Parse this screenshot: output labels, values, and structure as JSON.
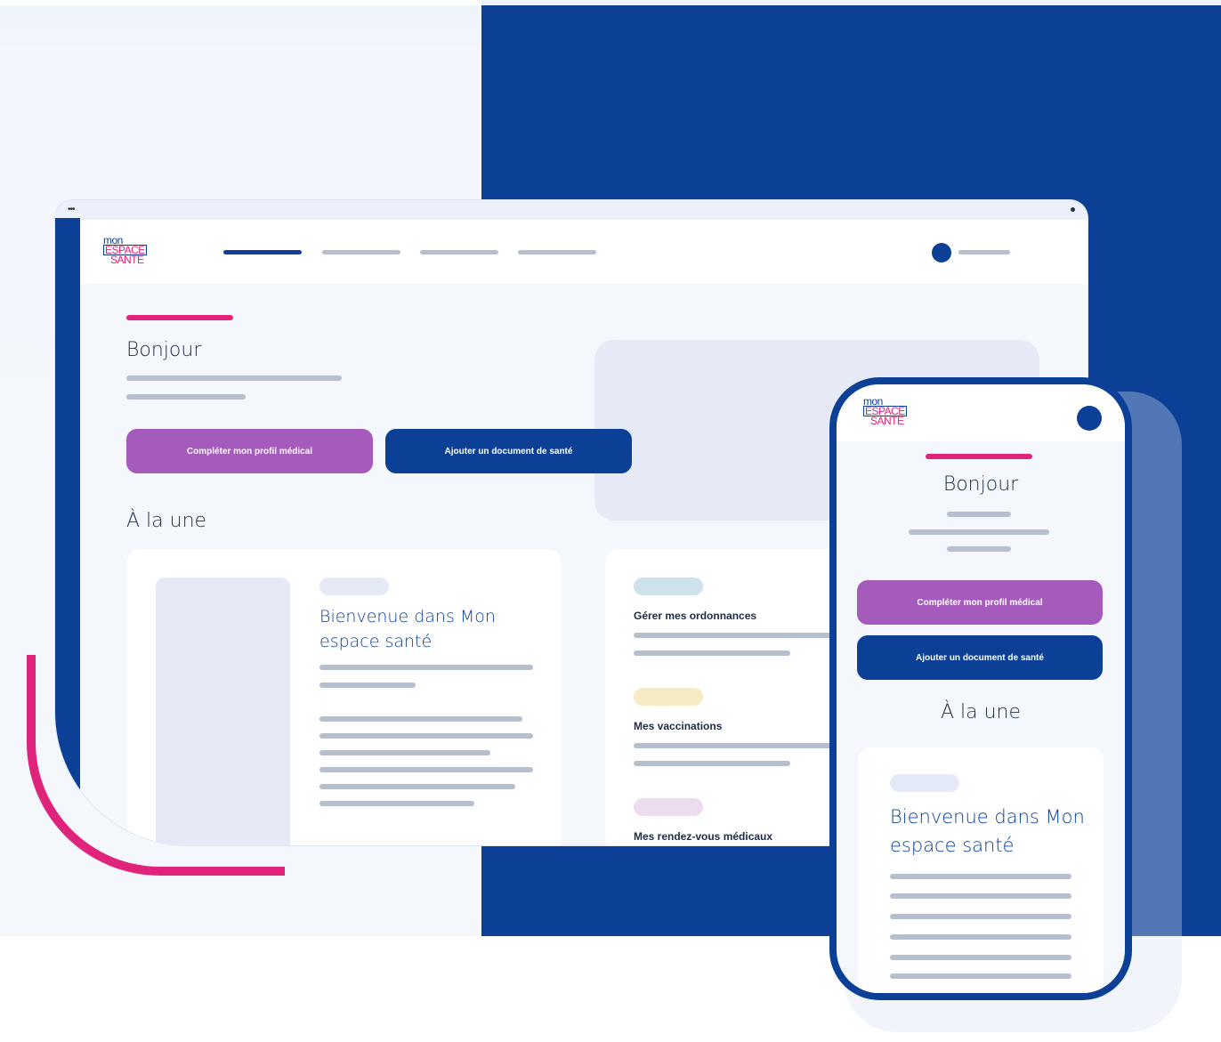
{
  "brand": {
    "logo_lines": [
      "mon",
      "ESPACE",
      "SANTÉ"
    ],
    "colors": {
      "primary": "#0c4097",
      "accent": "#e0237b",
      "purple": "#a45bbb",
      "background": "#f4f8fd"
    }
  },
  "desktop": {
    "window_controls": "•••",
    "greeting": "Bonjour",
    "buttons": {
      "complete_profile": "Compléter mon profil médical",
      "add_document": "Ajouter un document de santé"
    },
    "section_title": "À la une",
    "featured_card": {
      "title": "Bienvenue dans Mon espace santé"
    },
    "quick_links": [
      {
        "label": "Gérer mes ordonnances",
        "pill_color": "#cde2ea"
      },
      {
        "label": "Mes vaccinations",
        "pill_color": "#f7ebc4"
      },
      {
        "label": "Mes rendez-vous médicaux",
        "pill_color": "#ecdcee"
      }
    ]
  },
  "mobile": {
    "greeting": "Bonjour",
    "buttons": {
      "complete_profile": "Compléter mon profil médical",
      "add_document": "Ajouter un document de santé"
    },
    "section_title": "À la une",
    "featured_card": {
      "title": "Bienvenue dans Mon espace santé"
    }
  }
}
